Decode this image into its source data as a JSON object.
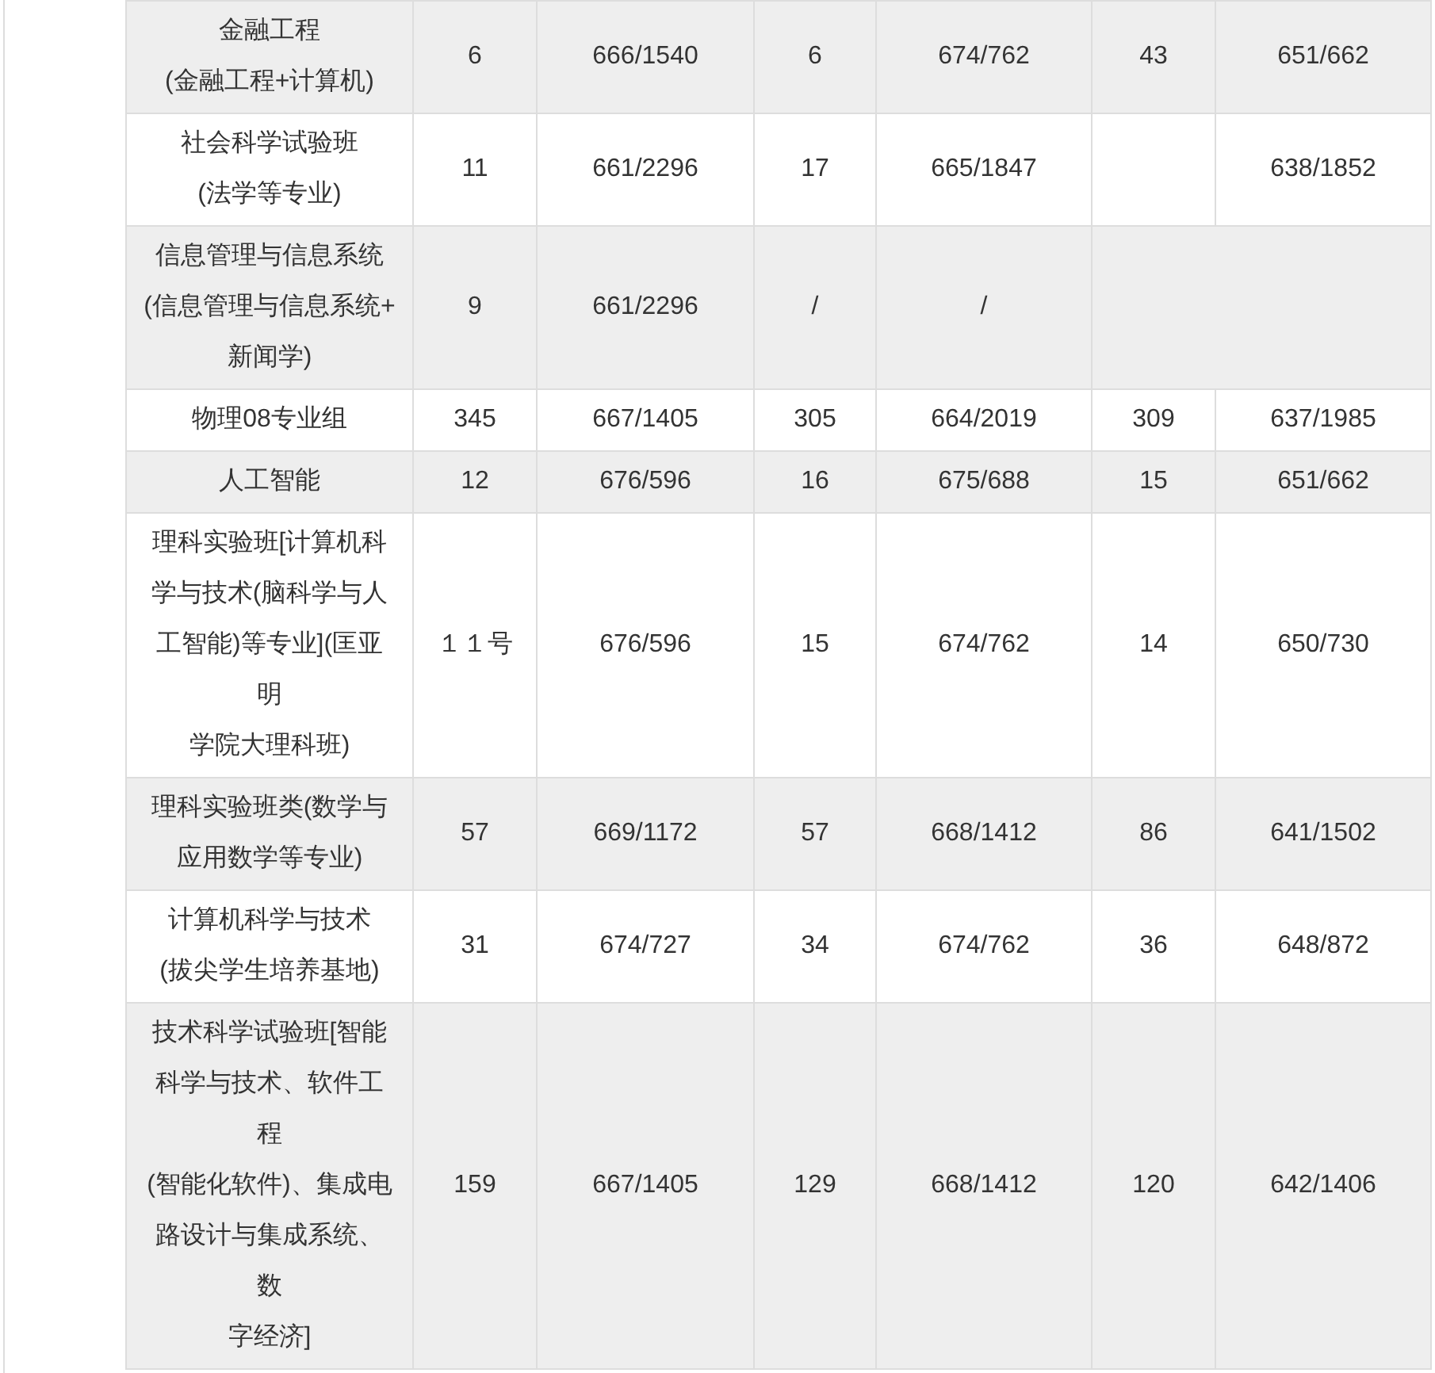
{
  "table": {
    "rows": [
      {
        "major": [
          "金融工程",
          "(金融工程+计算机)"
        ],
        "cells": [
          {
            "text": "6"
          },
          {
            "text": "666/1540"
          },
          {
            "text": "6"
          },
          {
            "text": "674/762"
          },
          {
            "text": "43"
          },
          {
            "text": "651/662"
          }
        ]
      },
      {
        "major": [
          "社会科学试验班",
          "(法学等专业)"
        ],
        "cells": [
          {
            "text": "11"
          },
          {
            "text": "661/2296"
          },
          {
            "text": "17"
          },
          {
            "text": "665/1847"
          },
          {
            "blank": true
          },
          {
            "text": "638/1852"
          }
        ]
      },
      {
        "major": [
          "信息管理与信息系统",
          "(信息管理与信息系统+",
          "新闻学)"
        ],
        "cells": [
          {
            "text": "9"
          },
          {
            "text": "661/2296"
          },
          {
            "text": "/"
          },
          {
            "text": "/"
          },
          {
            "blank": true,
            "wide": true
          }
        ]
      },
      {
        "major": [
          "物理08专业组"
        ],
        "cells": [
          {
            "text": "345"
          },
          {
            "text": "667/1405"
          },
          {
            "text": "305"
          },
          {
            "text": "664/2019"
          },
          {
            "text": "309"
          },
          {
            "text": "637/1985"
          }
        ]
      },
      {
        "major": [
          "人工智能"
        ],
        "cells": [
          {
            "text": "12"
          },
          {
            "text": "676/596"
          },
          {
            "text": "16"
          },
          {
            "text": "675/688"
          },
          {
            "text": "15"
          },
          {
            "text": "651/662"
          }
        ]
      },
      {
        "major": [
          "理科实验班[计算机科",
          "学与技术(脑科学与人",
          "工智能)等专业](匡亚",
          "明",
          "学院大理科班)"
        ],
        "cells": [
          {
            "text": "１１号"
          },
          {
            "text": "676/596"
          },
          {
            "text": "15"
          },
          {
            "text": "674/762"
          },
          {
            "text": "14"
          },
          {
            "text": "650/730"
          }
        ]
      },
      {
        "major": [
          "理科实验班类(数学与",
          "应用数学等专业)"
        ],
        "cells": [
          {
            "text": "57"
          },
          {
            "text": "669/1172"
          },
          {
            "text": "57"
          },
          {
            "text": "668/1412"
          },
          {
            "text": "86"
          },
          {
            "text": "641/1502"
          }
        ]
      },
      {
        "major": [
          "计算机科学与技术",
          "(拔尖学生培养基地)"
        ],
        "cells": [
          {
            "text": "31"
          },
          {
            "text": "674/727"
          },
          {
            "text": "34"
          },
          {
            "text": "674/762"
          },
          {
            "text": "36"
          },
          {
            "text": "648/872"
          }
        ]
      },
      {
        "major": [
          "技术科学试验班[智能",
          "科学与技术、软件工",
          "程",
          "(智能化软件)、集成电",
          "路设计与集成系统、",
          "数",
          "字经济]"
        ],
        "cells": [
          {
            "text": "159"
          },
          {
            "text": "667/1405"
          },
          {
            "text": "129"
          },
          {
            "text": "668/1412"
          },
          {
            "text": "120"
          },
          {
            "text": "642/1406"
          }
        ]
      }
    ]
  }
}
